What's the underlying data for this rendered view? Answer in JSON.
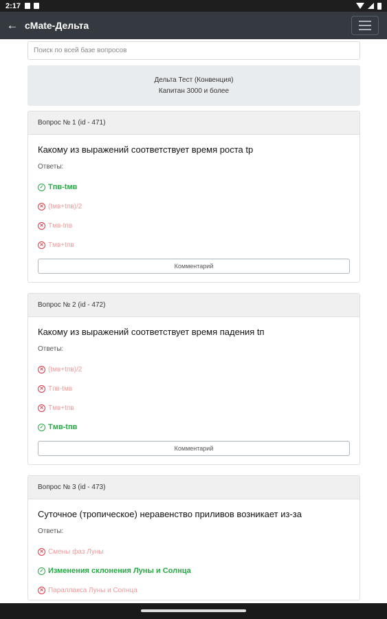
{
  "status": {
    "time": "2:17"
  },
  "appbar": {
    "title": "cMate-Дельта"
  },
  "search": {
    "placeholder": "Поиск по всей базе вопросов"
  },
  "test": {
    "title": "Дельта Тест (Конвенция)",
    "subtitle": "Капитан 3000 и более"
  },
  "answers_label": "Ответы:",
  "comment_label": "Комментарий",
  "questions": [
    {
      "header": "Вопрос № 1 (id - 471)",
      "text": "Какому из выражений соответствует время роста tр",
      "answers": [
        {
          "text": "Tпв-tмв",
          "correct": true
        },
        {
          "text": "(tмв+tпв)/2",
          "correct": false
        },
        {
          "text": "Tмв-tпв",
          "correct": false
        },
        {
          "text": "Tмв+tпв",
          "correct": false
        }
      ]
    },
    {
      "header": "Вопрос № 2 (id - 472)",
      "text": "Какому из выражений соответствует время падения tп",
      "answers": [
        {
          "text": "(tмв+tпв)/2",
          "correct": false
        },
        {
          "text": "Tпв-tмв",
          "correct": false
        },
        {
          "text": "Tмв+tпв",
          "correct": false
        },
        {
          "text": "Tмв-tпв",
          "correct": true
        }
      ]
    },
    {
      "header": "Вопрос № 3 (id - 473)",
      "text": "Суточное (тропическое) неравенство приливов возникает из-за",
      "answers": [
        {
          "text": "Смены фаз Луны",
          "correct": false
        },
        {
          "text": "Изменения склонения Луны и Солнца",
          "correct": true
        },
        {
          "text": "Параллакса Луны и Солнца",
          "correct": false
        }
      ]
    }
  ],
  "colors": {
    "appbar": "#343a40",
    "correct": "#28a745",
    "wrong": "#dc3545"
  },
  "icons": {
    "correct": "check-circle-icon",
    "wrong": "x-circle-icon"
  }
}
